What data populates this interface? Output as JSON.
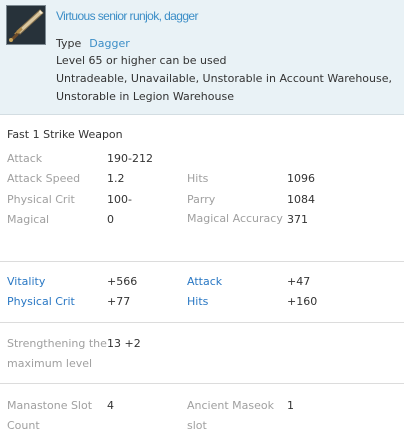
{
  "item": {
    "name": "Virtuous senior runjok, dagger",
    "type_label": "Type",
    "type_value": "Dagger",
    "level_req": "Level 65 or higher can be used",
    "restrictions": "Untradeable, Unavailable, Unstorable in Account Warehouse, Unstorable in Legion Warehouse",
    "weapon_speed": "Fast 1 Strike Weapon"
  },
  "base_stats": [
    {
      "label": "Attack",
      "value": "190-212"
    },
    {
      "label": "Attack Speed",
      "value": "1.2"
    },
    {
      "label": "Physical Crit",
      "value": "100-"
    },
    {
      "label": "Magical",
      "value": "0"
    },
    {
      "label": "Hits",
      "value": "1096"
    },
    {
      "label": "Parry",
      "value": "1084"
    },
    {
      "label": "Magical Accuracy",
      "value": "371"
    }
  ],
  "bonus_stats": [
    {
      "label": "Vitality",
      "value": "+566"
    },
    {
      "label": "Attack",
      "value": "+47"
    },
    {
      "label": "Physical Crit",
      "value": "+77"
    },
    {
      "label": "Hits",
      "value": "+160"
    }
  ],
  "enhance": {
    "label": "Strengthening the maximum level",
    "value": "13 +2"
  },
  "slots": [
    {
      "label": "Manastone Slot Count",
      "value": "4"
    },
    {
      "label": "Ancient Maseok slot",
      "value": "1"
    }
  ],
  "colors": {
    "header_bg": "#e9f2f6",
    "accent_blue": "#3c8ec7",
    "label_gray": "#a0a0a0"
  },
  "icons": {
    "item": "dagger-icon"
  }
}
